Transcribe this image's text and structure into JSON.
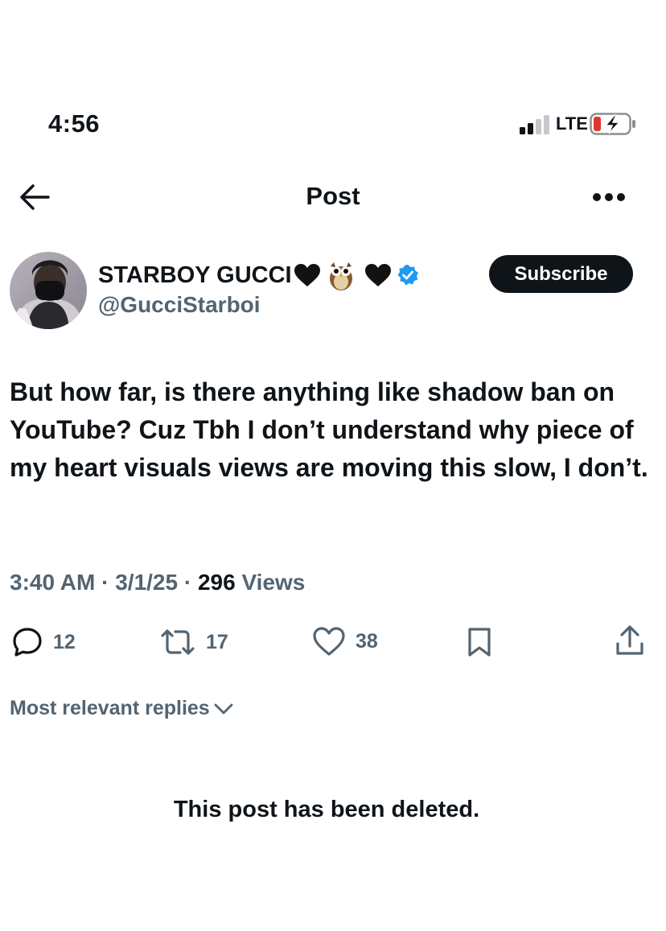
{
  "status_bar": {
    "time": "4:56",
    "network": "LTE"
  },
  "nav": {
    "title": "Post"
  },
  "author": {
    "display_name": "STARBOY GUCCI",
    "handle": "@GucciStarboi",
    "subscribe_label": "Subscribe"
  },
  "post": {
    "text": "But how far, is there anything like shadow ban on YouTube? Cuz Tbh I don’t understand why piece of my heart visuals views are moving this slow, I don’t.",
    "time": "3:40 AM",
    "date": "3/1/25",
    "separator": "·",
    "views_count": "296",
    "views_label": "Views"
  },
  "actions": {
    "reply_count": "12",
    "repost_count": "17",
    "like_count": "38"
  },
  "replies": {
    "sort_label": "Most relevant replies"
  },
  "deleted_notice": "This post has been deleted.",
  "icons": [
    "back-arrow-icon",
    "more-icon",
    "verified-badge-icon",
    "reply-icon",
    "repost-icon",
    "like-icon",
    "bookmark-icon",
    "share-icon",
    "chevron-down-icon",
    "signal-icon",
    "battery-charging-icon"
  ],
  "colors": {
    "text": "#0f1419",
    "secondary": "#536471",
    "verified": "#1d9bf0",
    "battery_low": "#e0382f"
  }
}
